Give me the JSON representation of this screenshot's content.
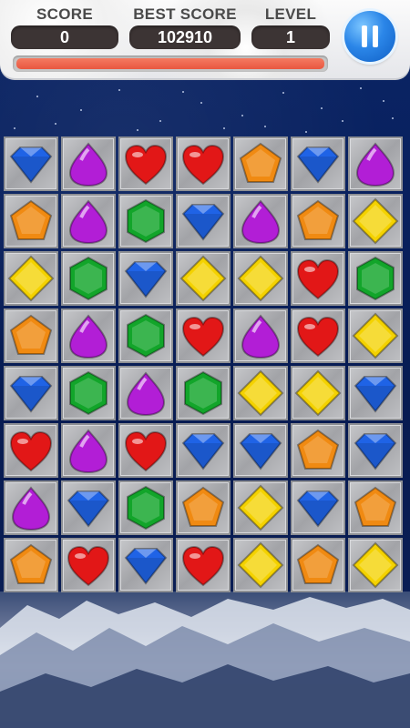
{
  "hud": {
    "score_label": "SCORE",
    "score_value": "0",
    "best_label": "BEST SCORE",
    "best_value": "102910",
    "level_label": "LEVEL",
    "level_value": "1",
    "progress_fraction": 1.0
  },
  "colors": {
    "blue": "#1f63e6",
    "purple": "#b21ed6",
    "red": "#e21717",
    "orange": "#f08a12",
    "yellow": "#f4d200",
    "green": "#12a52a"
  },
  "board": {
    "rows": 8,
    "cols": 7,
    "gems": [
      [
        "blue",
        "purple",
        "red",
        "red",
        "orange",
        "blue",
        "purple"
      ],
      [
        "orange",
        "purple",
        "green",
        "blue",
        "purple",
        "orange",
        "yellow"
      ],
      [
        "yellow",
        "green",
        "blue",
        "yellow",
        "yellow",
        "red",
        "green"
      ],
      [
        "orange",
        "purple",
        "green",
        "red",
        "purple",
        "red",
        "yellow"
      ],
      [
        "blue",
        "green",
        "purple",
        "green",
        "yellow",
        "yellow",
        "blue"
      ],
      [
        "red",
        "purple",
        "red",
        "blue",
        "blue",
        "orange",
        "blue"
      ],
      [
        "purple",
        "blue",
        "green",
        "orange",
        "yellow",
        "blue",
        "orange"
      ],
      [
        "orange",
        "red",
        "blue",
        "red",
        "yellow",
        "orange",
        "yellow"
      ]
    ],
    "shape_map": {
      "blue": "diamond-gem-icon",
      "purple": "drop-gem-icon",
      "red": "heart-gem-icon",
      "orange": "pentagon-gem-icon",
      "yellow": "rhombus-gem-icon",
      "green": "hexagon-gem-icon"
    }
  }
}
